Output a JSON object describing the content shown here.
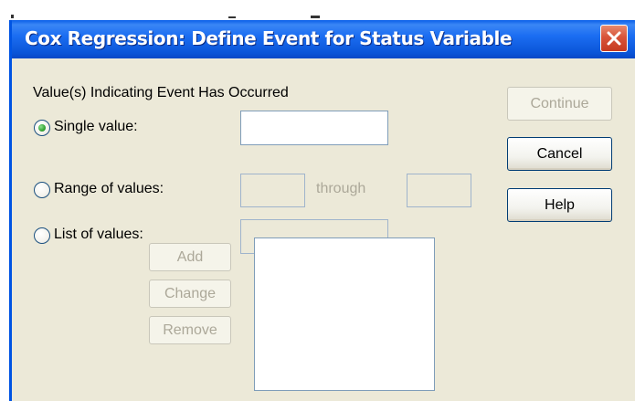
{
  "dialog": {
    "title": "Cox Regression: Define Event for Status Variable",
    "close_icon": "close-icon"
  },
  "group": {
    "label": "Value(s) Indicating Event Has Occurred"
  },
  "options": {
    "single": {
      "label": "Single value:",
      "selected": true,
      "value": ""
    },
    "range": {
      "label": "Range of values:",
      "selected": false,
      "from": "",
      "through_label": "through",
      "to": ""
    },
    "list": {
      "label": "List of values:",
      "selected": false,
      "value": ""
    }
  },
  "list_buttons": {
    "add": "Add",
    "change": "Change",
    "remove": "Remove"
  },
  "list_items": [],
  "actions": {
    "continue": "Continue",
    "cancel": "Cancel",
    "help": "Help"
  },
  "colors": {
    "titlebar": "#0a55d8",
    "dialog_bg": "#ece9d8",
    "disabled_text": "#aca899",
    "radio_selected": "#3aaa3a",
    "close_button": "#c63a20"
  }
}
